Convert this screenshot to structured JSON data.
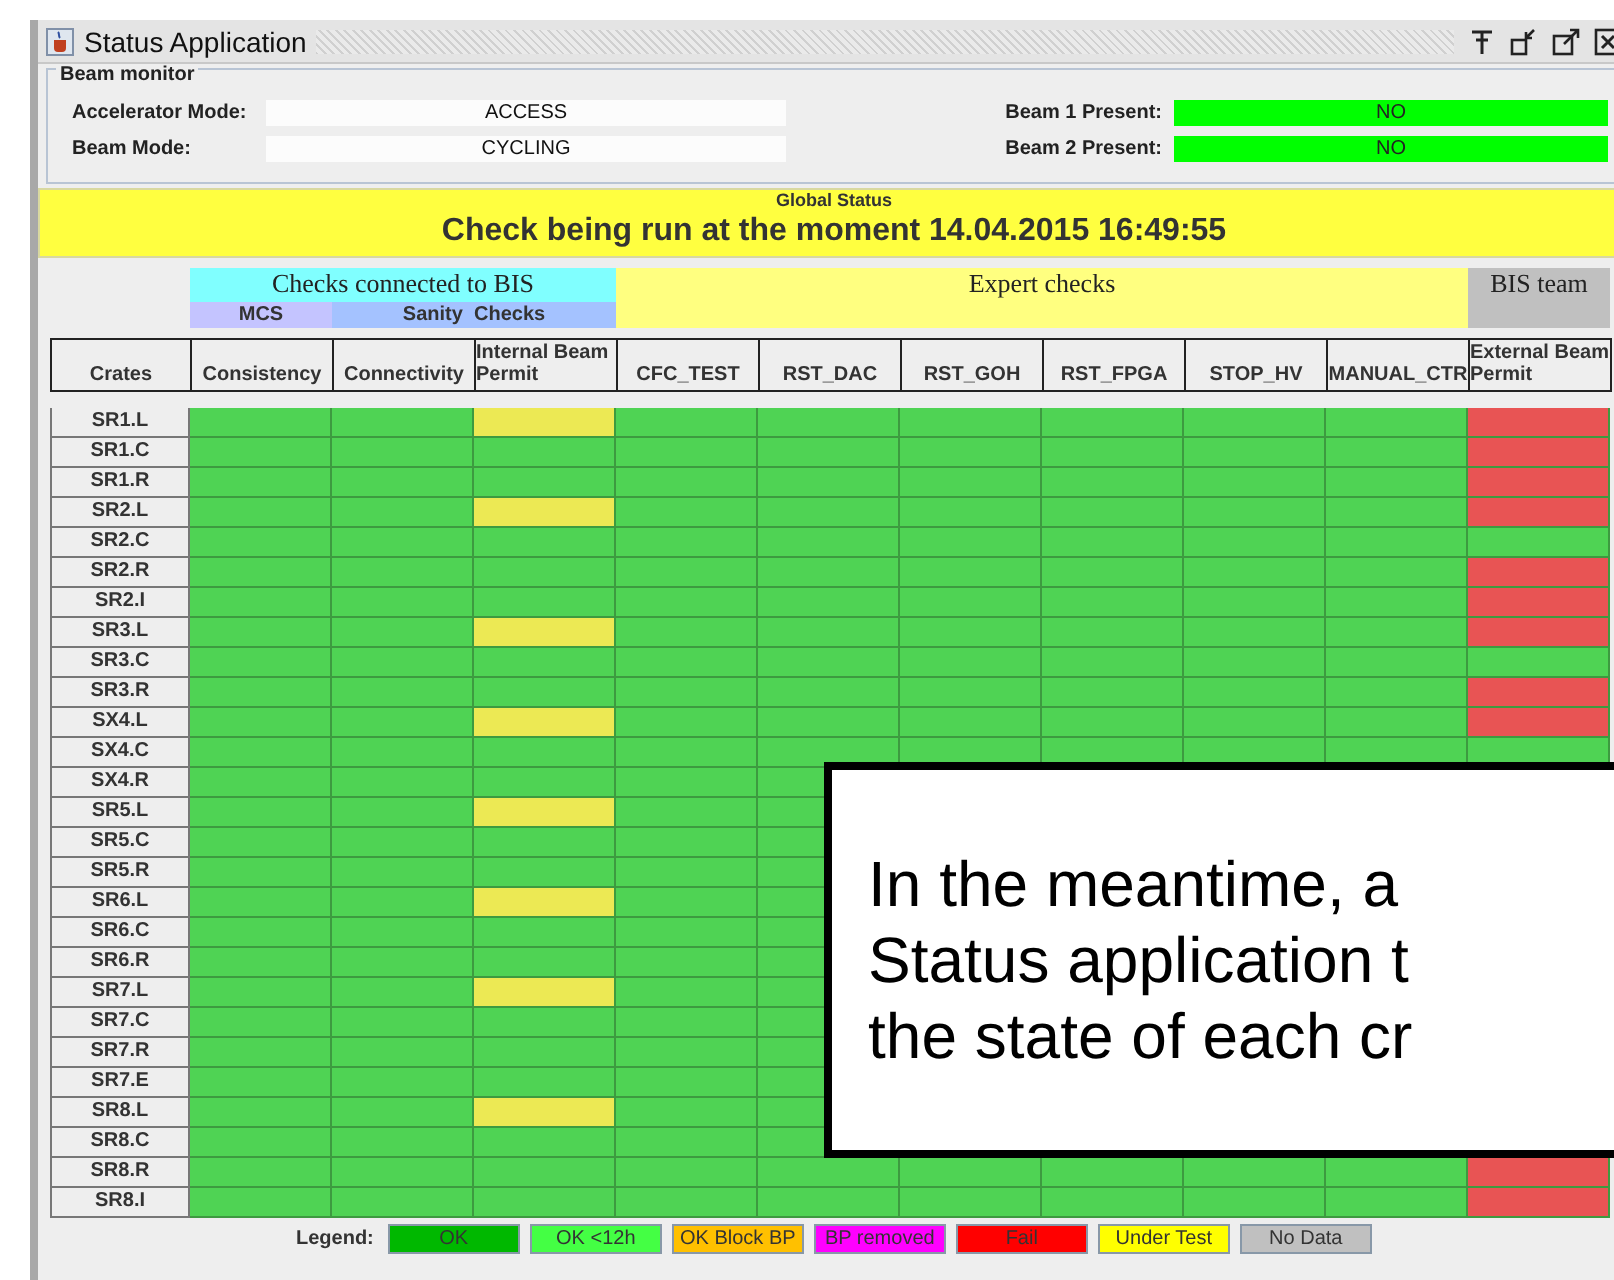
{
  "window": {
    "title": "Status Application"
  },
  "beam_monitor": {
    "title": "Beam monitor",
    "modes": [
      {
        "label": "Accelerator Mode:",
        "value": "ACCESS"
      },
      {
        "label": "Beam Mode:",
        "value": "CYCLING"
      }
    ],
    "beams": [
      {
        "label": "Beam 1 Present:",
        "value": "NO",
        "color": "#00ff00"
      },
      {
        "label": "Beam 2 Present:",
        "value": "NO",
        "color": "#00ff00"
      }
    ]
  },
  "global_status": {
    "title": "Global Status",
    "message": "Check being run at the moment  14.04.2015 16:49:55"
  },
  "table": {
    "crate_header": "Crates",
    "groups": [
      {
        "label": "Checks connected to BIS",
        "color": "#80ffff",
        "subgroups": [
          {
            "label": "MCS",
            "color": "#c4c4ff",
            "columns": [
              "Consistency"
            ]
          },
          {
            "label": "Sanity  Checks",
            "color": "#a4c2ff",
            "columns": [
              "Connectivity",
              "Internal Beam Permit"
            ]
          }
        ]
      },
      {
        "label": "Expert  checks",
        "color": "#ffff80",
        "subgroups": [
          {
            "columns": [
              "CFC_TEST",
              "RST_DAC",
              "RST_GOH",
              "RST_FPGA",
              "STOP_HV",
              "MANUAL_CTR"
            ]
          }
        ]
      },
      {
        "label": "BIS team",
        "color": "#c0c0c0",
        "subgroups": [
          {
            "columns": [
              "External Beam Permit"
            ]
          }
        ]
      }
    ],
    "rows": [
      {
        "crate": "SR1.L",
        "cells": [
          {
            "color": "#4fd354"
          },
          {
            "color": "#4fd354"
          },
          {
            "color": "#ece954"
          },
          {
            "color": "#4fd354"
          },
          {
            "color": "#4fd354"
          },
          {
            "color": "#4fd354"
          },
          {
            "color": "#4fd354"
          },
          {
            "color": "#4fd354"
          },
          {
            "color": "#4fd354"
          },
          {
            "color": "#e85454"
          }
        ]
      },
      {
        "crate": "SR1.C",
        "cells": [
          {
            "color": "#4fd354"
          },
          {
            "color": "#4fd354"
          },
          {
            "color": "#4fd354"
          },
          {
            "color": "#4fd354"
          },
          {
            "color": "#4fd354"
          },
          {
            "color": "#4fd354"
          },
          {
            "color": "#4fd354"
          },
          {
            "color": "#4fd354"
          },
          {
            "color": "#4fd354"
          },
          {
            "color": "#e85454"
          }
        ]
      },
      {
        "crate": "SR1.R",
        "cells": [
          {
            "color": "#4fd354"
          },
          {
            "color": "#4fd354"
          },
          {
            "color": "#4fd354"
          },
          {
            "color": "#4fd354"
          },
          {
            "color": "#4fd354"
          },
          {
            "color": "#4fd354"
          },
          {
            "color": "#4fd354"
          },
          {
            "color": "#4fd354"
          },
          {
            "color": "#4fd354"
          },
          {
            "color": "#e85454"
          }
        ]
      },
      {
        "crate": "SR2.L",
        "cells": [
          {
            "color": "#4fd354"
          },
          {
            "color": "#4fd354"
          },
          {
            "color": "#ece954"
          },
          {
            "color": "#4fd354"
          },
          {
            "color": "#4fd354"
          },
          {
            "color": "#4fd354"
          },
          {
            "color": "#4fd354"
          },
          {
            "color": "#4fd354"
          },
          {
            "color": "#4fd354"
          },
          {
            "color": "#e85454"
          }
        ]
      },
      {
        "crate": "SR2.C",
        "cells": [
          {
            "color": "#4fd354"
          },
          {
            "color": "#4fd354"
          },
          {
            "color": "#4fd354"
          },
          {
            "color": "#4fd354"
          },
          {
            "color": "#4fd354"
          },
          {
            "color": "#4fd354"
          },
          {
            "color": "#4fd354"
          },
          {
            "color": "#4fd354"
          },
          {
            "color": "#4fd354"
          },
          {
            "color": "#4fd354"
          }
        ]
      },
      {
        "crate": "SR2.R",
        "cells": [
          {
            "color": "#4fd354"
          },
          {
            "color": "#4fd354"
          },
          {
            "color": "#4fd354"
          },
          {
            "color": "#4fd354"
          },
          {
            "color": "#4fd354"
          },
          {
            "color": "#4fd354"
          },
          {
            "color": "#4fd354"
          },
          {
            "color": "#4fd354"
          },
          {
            "color": "#4fd354"
          },
          {
            "color": "#e85454"
          }
        ]
      },
      {
        "crate": "SR2.I",
        "cells": [
          {
            "color": "#4fd354"
          },
          {
            "color": "#4fd354"
          },
          {
            "color": "#4fd354"
          },
          {
            "color": "#4fd354"
          },
          {
            "color": "#4fd354"
          },
          {
            "color": "#4fd354"
          },
          {
            "color": "#4fd354"
          },
          {
            "color": "#4fd354"
          },
          {
            "color": "#4fd354"
          },
          {
            "color": "#e85454"
          }
        ]
      },
      {
        "crate": "SR3.L",
        "cells": [
          {
            "color": "#4fd354"
          },
          {
            "color": "#4fd354"
          },
          {
            "color": "#ece954"
          },
          {
            "color": "#4fd354"
          },
          {
            "color": "#4fd354"
          },
          {
            "color": "#4fd354"
          },
          {
            "color": "#4fd354"
          },
          {
            "color": "#4fd354"
          },
          {
            "color": "#4fd354"
          },
          {
            "color": "#e85454"
          }
        ]
      },
      {
        "crate": "SR3.C",
        "cells": [
          {
            "color": "#4fd354"
          },
          {
            "color": "#4fd354"
          },
          {
            "color": "#4fd354"
          },
          {
            "color": "#4fd354"
          },
          {
            "color": "#4fd354"
          },
          {
            "color": "#4fd354"
          },
          {
            "color": "#4fd354"
          },
          {
            "color": "#4fd354"
          },
          {
            "color": "#4fd354"
          },
          {
            "color": "#4fd354"
          }
        ]
      },
      {
        "crate": "SR3.R",
        "cells": [
          {
            "color": "#4fd354"
          },
          {
            "color": "#4fd354"
          },
          {
            "color": "#4fd354"
          },
          {
            "color": "#4fd354"
          },
          {
            "color": "#4fd354"
          },
          {
            "color": "#4fd354"
          },
          {
            "color": "#4fd354"
          },
          {
            "color": "#4fd354"
          },
          {
            "color": "#4fd354"
          },
          {
            "color": "#e85454"
          }
        ]
      },
      {
        "crate": "SX4.L",
        "cells": [
          {
            "color": "#4fd354"
          },
          {
            "color": "#4fd354"
          },
          {
            "color": "#ece954"
          },
          {
            "color": "#4fd354"
          },
          {
            "color": "#4fd354"
          },
          {
            "color": "#4fd354"
          },
          {
            "color": "#4fd354"
          },
          {
            "color": "#4fd354"
          },
          {
            "color": "#4fd354"
          },
          {
            "color": "#e85454"
          }
        ]
      },
      {
        "crate": "SX4.C",
        "cells": [
          {
            "color": "#4fd354"
          },
          {
            "color": "#4fd354"
          },
          {
            "color": "#4fd354"
          },
          {
            "color": "#4fd354"
          },
          {
            "color": "#4fd354"
          },
          {
            "color": "#4fd354"
          },
          {
            "color": "#4fd354"
          },
          {
            "color": "#4fd354"
          },
          {
            "color": "#4fd354"
          },
          {
            "color": "#4fd354"
          }
        ]
      },
      {
        "crate": "SX4.R",
        "cells": [
          {
            "color": "#4fd354"
          },
          {
            "color": "#4fd354"
          },
          {
            "color": "#4fd354"
          },
          {
            "color": "#4fd354"
          },
          {
            "color": "#4fd354"
          },
          null,
          null,
          null,
          null,
          null
        ]
      },
      {
        "crate": "SR5.L",
        "cells": [
          {
            "color": "#4fd354"
          },
          {
            "color": "#4fd354"
          },
          {
            "color": "#ece954"
          },
          {
            "color": "#4fd354"
          },
          null,
          null,
          null,
          null,
          null,
          null
        ]
      },
      {
        "crate": "SR5.C",
        "cells": [
          {
            "color": "#4fd354"
          },
          {
            "color": "#4fd354"
          },
          {
            "color": "#4fd354"
          },
          {
            "color": "#4fd354"
          },
          null,
          null,
          null,
          null,
          null,
          null
        ]
      },
      {
        "crate": "SR5.R",
        "cells": [
          {
            "color": "#4fd354"
          },
          {
            "color": "#4fd354"
          },
          {
            "color": "#4fd354"
          },
          {
            "color": "#4fd354"
          },
          null,
          null,
          null,
          null,
          null,
          null
        ]
      },
      {
        "crate": "SR6.L",
        "cells": [
          {
            "color": "#4fd354"
          },
          {
            "color": "#4fd354"
          },
          {
            "color": "#ece954"
          },
          {
            "color": "#4fd354"
          },
          null,
          null,
          null,
          null,
          null,
          null
        ]
      },
      {
        "crate": "SR6.C",
        "cells": [
          {
            "color": "#4fd354"
          },
          {
            "color": "#4fd354"
          },
          {
            "color": "#4fd354"
          },
          {
            "color": "#4fd354"
          },
          null,
          null,
          null,
          null,
          null,
          null
        ]
      },
      {
        "crate": "SR6.R",
        "cells": [
          {
            "color": "#4fd354"
          },
          {
            "color": "#4fd354"
          },
          {
            "color": "#4fd354"
          },
          {
            "color": "#4fd354"
          },
          null,
          null,
          null,
          null,
          null,
          null
        ]
      },
      {
        "crate": "SR7.L",
        "cells": [
          {
            "color": "#4fd354"
          },
          {
            "color": "#4fd354"
          },
          {
            "color": "#ece954"
          },
          {
            "color": "#4fd354"
          },
          null,
          null,
          null,
          null,
          null,
          null
        ]
      },
      {
        "crate": "SR7.C",
        "cells": [
          {
            "color": "#4fd354"
          },
          {
            "color": "#4fd354"
          },
          {
            "color": "#4fd354"
          },
          {
            "color": "#4fd354"
          },
          null,
          null,
          null,
          null,
          null,
          null
        ]
      },
      {
        "crate": "SR7.R",
        "cells": [
          {
            "color": "#4fd354"
          },
          {
            "color": "#4fd354"
          },
          {
            "color": "#4fd354"
          },
          {
            "color": "#4fd354"
          },
          null,
          null,
          null,
          null,
          null,
          null
        ]
      },
      {
        "crate": "SR7.E",
        "cells": [
          {
            "color": "#4fd354"
          },
          {
            "color": "#4fd354"
          },
          {
            "color": "#4fd354"
          },
          {
            "color": "#4fd354"
          },
          null,
          null,
          null,
          null,
          null,
          null
        ]
      },
      {
        "crate": "SR8.L",
        "cells": [
          {
            "color": "#4fd354"
          },
          {
            "color": "#4fd354"
          },
          {
            "color": "#ece954"
          },
          {
            "color": "#4fd354"
          },
          null,
          null,
          null,
          null,
          null,
          null
        ]
      },
      {
        "crate": "SR8.C",
        "cells": [
          {
            "color": "#4fd354"
          },
          {
            "color": "#4fd354"
          },
          {
            "color": "#4fd354"
          },
          {
            "color": "#4fd354"
          },
          null,
          null,
          null,
          null,
          null,
          null
        ]
      },
      {
        "crate": "SR8.R",
        "cells": [
          {
            "color": "#4fd354"
          },
          {
            "color": "#4fd354"
          },
          {
            "color": "#4fd354"
          },
          {
            "color": "#4fd354"
          },
          {
            "color": "#4fd354"
          },
          {
            "color": "#4fd354"
          },
          {
            "color": "#4fd354"
          },
          {
            "color": "#4fd354"
          },
          {
            "color": "#4fd354"
          },
          {
            "color": "#e85454"
          }
        ]
      },
      {
        "crate": "SR8.I",
        "cells": [
          {
            "color": "#4fd354"
          },
          {
            "color": "#4fd354"
          },
          {
            "color": "#4fd354"
          },
          {
            "color": "#4fd354"
          },
          {
            "color": "#4fd354"
          },
          {
            "color": "#4fd354"
          },
          {
            "color": "#4fd354"
          },
          {
            "color": "#4fd354"
          },
          {
            "color": "#4fd354"
          },
          {
            "color": "#e85454"
          }
        ]
      }
    ]
  },
  "legend": {
    "label": "Legend:",
    "items": [
      {
        "label": "OK",
        "color": "#00b800"
      },
      {
        "label": "OK <12h",
        "color": "#44ff44"
      },
      {
        "label": "OK Block BP",
        "color": "#ffc000"
      },
      {
        "label": "BP removed",
        "color": "#ff00ff"
      },
      {
        "label": "Fail",
        "color": "#ff0000"
      },
      {
        "label": "Under Test",
        "color": "#ffff00"
      },
      {
        "label": "No Data",
        "color": "#c0c0c0"
      }
    ]
  },
  "callout": {
    "lines": [
      "In the meantime, a",
      "Status application t",
      "the state of each cr"
    ]
  }
}
